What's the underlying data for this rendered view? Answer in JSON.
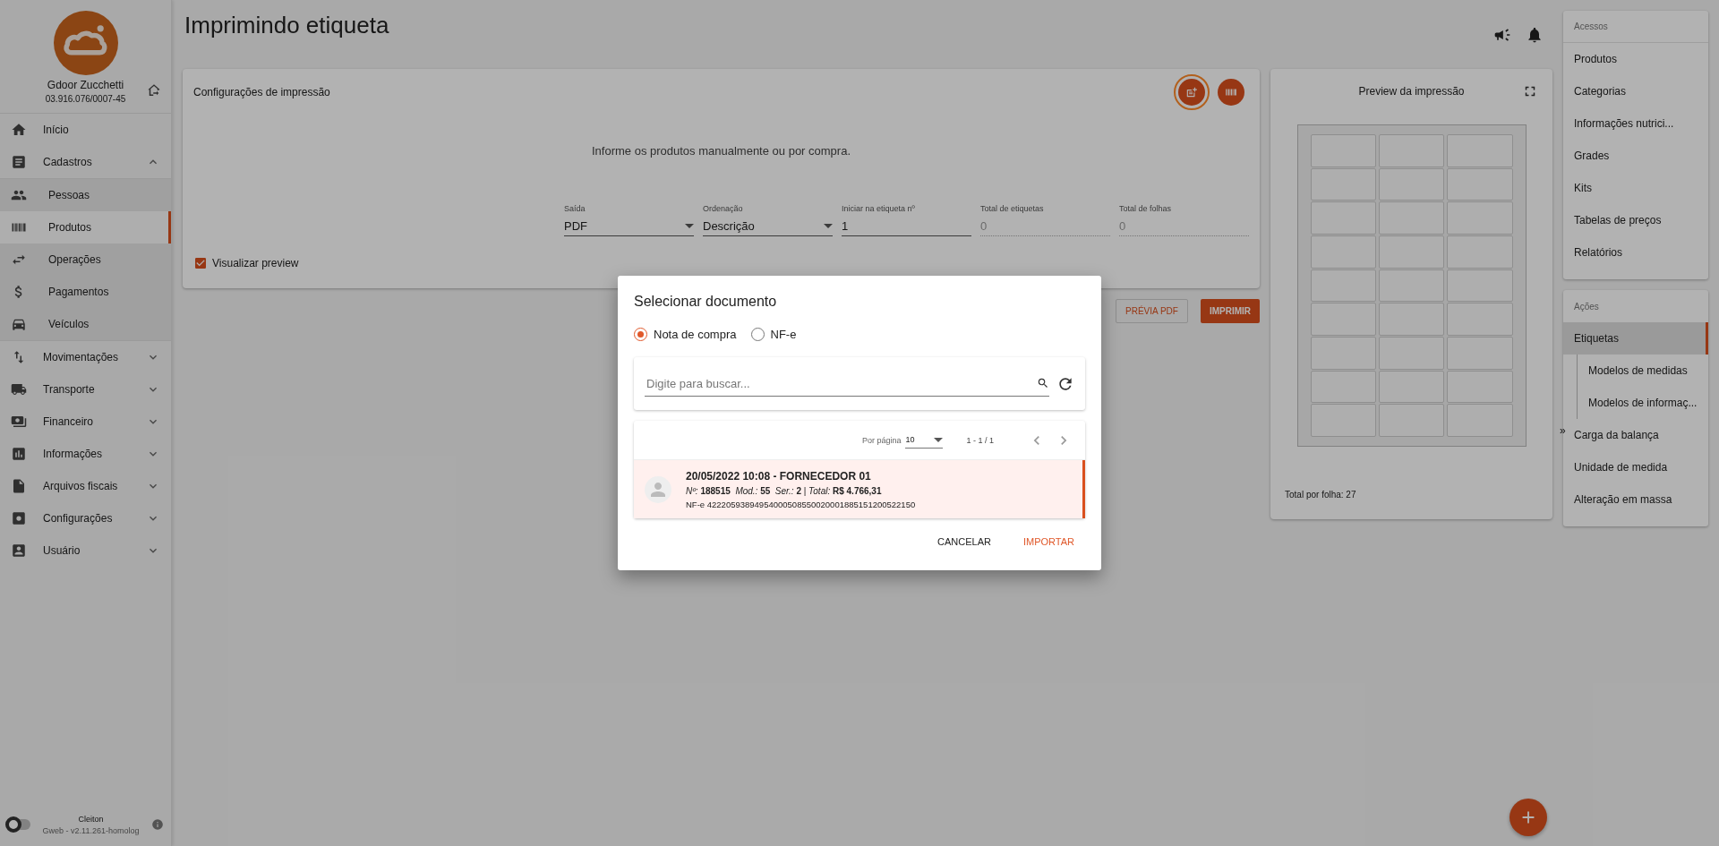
{
  "sidebar": {
    "company": {
      "name": "Gdoor Zucchetti",
      "cnpj": "03.916.076/0007-45"
    },
    "items": [
      {
        "label": "Início",
        "selected": false
      },
      {
        "label": "Cadastros",
        "selected": false,
        "expanded": true,
        "children": [
          {
            "label": "Pessoas",
            "selected": false
          },
          {
            "label": "Produtos",
            "selected": true
          },
          {
            "label": "Operações",
            "selected": false
          },
          {
            "label": "Pagamentos",
            "selected": false
          },
          {
            "label": "Veículos",
            "selected": false
          }
        ]
      },
      {
        "label": "Movimentações",
        "selected": false,
        "expanded": false
      },
      {
        "label": "Transporte",
        "selected": false,
        "expanded": false
      },
      {
        "label": "Financeiro",
        "selected": false,
        "expanded": false
      },
      {
        "label": "Informações",
        "selected": false,
        "expanded": false
      },
      {
        "label": "Arquivos fiscais",
        "selected": false,
        "expanded": false
      },
      {
        "label": "Configurações",
        "selected": false,
        "expanded": false
      },
      {
        "label": "Usuário",
        "selected": false,
        "expanded": false
      }
    ],
    "footer": {
      "user": "Cleiton",
      "version": "Gweb - v2.11.261-homolog",
      "dark_mode": false
    }
  },
  "page": {
    "title": "Imprimindo etiqueta"
  },
  "config_card": {
    "title": "Configurações de impressão",
    "header_buttons": [
      {
        "focused": true
      },
      {
        "focused": false
      }
    ],
    "message": "Informe os produtos manualmente ou por compra.",
    "fields": [
      {
        "kind": "select",
        "label": "Saída",
        "value": "PDF"
      },
      {
        "kind": "select",
        "label": "Ordenação",
        "value": "Descrição"
      },
      {
        "kind": "input",
        "label": "Iniciar na etiqueta nº",
        "value": "1"
      },
      {
        "kind": "readonly",
        "label": "Total de etiquetas",
        "value": "0"
      },
      {
        "kind": "readonly",
        "label": "Total de folhas",
        "value": "0"
      }
    ],
    "preview_checkbox": {
      "label": "Visualizar preview",
      "checked": true
    }
  },
  "actions": [
    {
      "kind": "outlined",
      "label": "PRÉVIA PDF"
    },
    {
      "kind": "filled",
      "label": "IMPRIMIR"
    }
  ],
  "preview": {
    "title": "Preview da impressão",
    "footer": "Total por folha: 27"
  },
  "right_panel": {
    "collapse_handle": "»",
    "sections": [
      {
        "title": "Acessos",
        "items": [
          {
            "label": "Produtos",
            "selected": false
          },
          {
            "label": "Categorias",
            "selected": false
          },
          {
            "label": "Informações nutrici...",
            "selected": false
          },
          {
            "label": "Grades",
            "selected": false
          },
          {
            "label": "Kits",
            "selected": false
          },
          {
            "label": "Tabelas de preços",
            "selected": false
          },
          {
            "label": "Relatórios",
            "selected": false
          }
        ]
      },
      {
        "title": "Ações",
        "items": [
          {
            "label": "Etiquetas",
            "selected": true,
            "children": [
              {
                "label": "Modelos de medidas",
                "selected": false
              },
              {
                "label": "Modelos de informaç...",
                "selected": false
              }
            ]
          },
          {
            "label": "Carga da balança",
            "selected": false
          },
          {
            "label": "Unidade de medida",
            "selected": false
          },
          {
            "label": "Alteração em massa",
            "selected": false
          }
        ]
      }
    ]
  },
  "dialog": {
    "title": "Selecionar documento",
    "radios": [
      {
        "label": "Nota de compra",
        "selected": true
      },
      {
        "label": "NF-e",
        "selected": false
      }
    ],
    "search": {
      "placeholder": "Digite para buscar..."
    },
    "pagination": {
      "per_page_label": "Por página",
      "per_page": "10",
      "range": "1 - 1 / 1"
    },
    "documents": [
      {
        "title": "20/05/2022 10:08 - FORNECEDOR 01",
        "details": "*Nº:* **188515**  *Mod.:* **55**  *Ser.:* **2** | *Total:* **R$ 4.766,31**",
        "key": "NF-e 42220593894954000508550020001885151200522150",
        "selected": true
      }
    ],
    "buttons": [
      {
        "kind": "text",
        "label": "CANCELAR"
      },
      {
        "kind": "primary",
        "label": "IMPORTAR"
      }
    ]
  }
}
